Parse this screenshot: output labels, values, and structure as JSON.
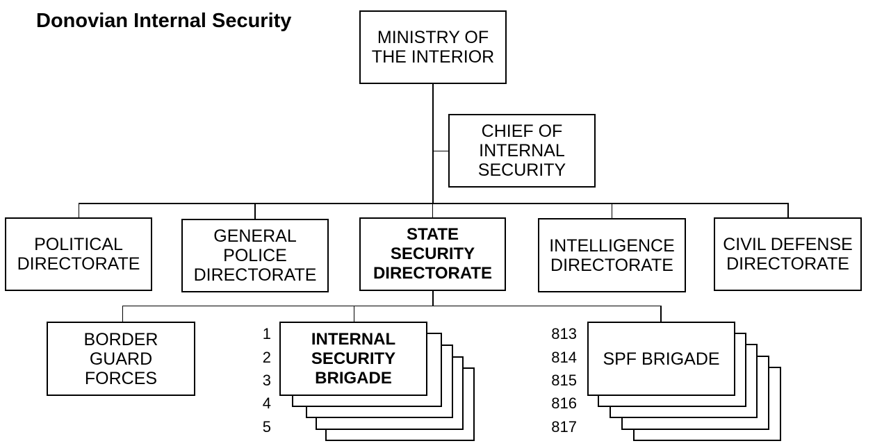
{
  "title": "Donovian Internal Security",
  "nodes": {
    "ministry": "MINISTRY OF\nTHE INTERIOR",
    "chief": "CHIEF OF\nINTERNAL\nSECURITY",
    "political": "POLITICAL\nDIRECTORATE",
    "general_police": "GENERAL\nPOLICE\nDIRECTORATE",
    "state_security": "STATE\nSECURITY\nDIRECTORATE",
    "intelligence": "INTELLIGENCE\nDIRECTORATE",
    "civil_defense": "CIVIL DEFENSE\nDIRECTORATE",
    "border_guard": "BORDER\nGUARD\nFORCES",
    "internal_security_brigade": "INTERNAL\nSECURITY\nBRIGADE",
    "spf_brigade": "SPF BRIGADE"
  },
  "internal_security_brigade_numbers": [
    "1",
    "2",
    "3",
    "4",
    "5"
  ],
  "spf_brigade_numbers": [
    "813",
    "814",
    "815",
    "816",
    "817"
  ]
}
